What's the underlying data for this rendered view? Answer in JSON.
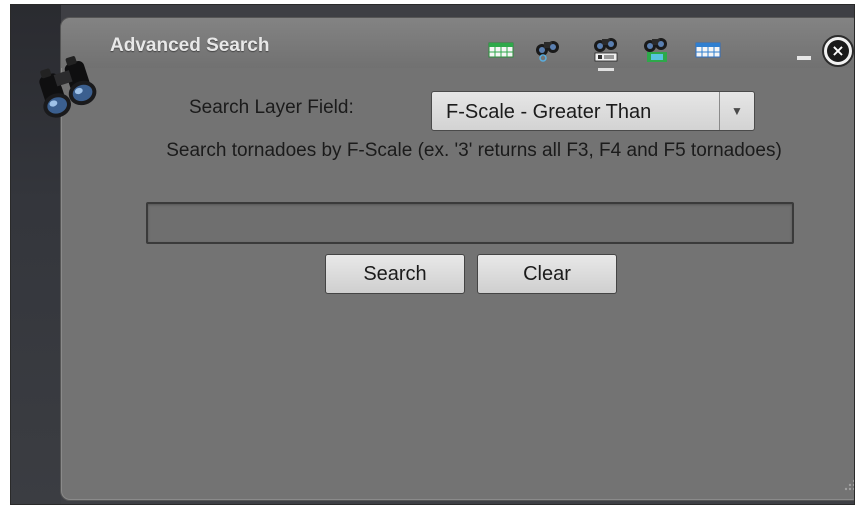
{
  "window": {
    "title": "Advanced Search",
    "toolbar_icons": [
      "table-icon",
      "binoculars-select-icon",
      "binoculars-text-icon",
      "binoculars-map-icon",
      "grid-table-icon"
    ],
    "active_tool": "binoculars-text-icon"
  },
  "form": {
    "field_label": "Search Layer Field:",
    "selected_field": "F-Scale - Greater Than",
    "help_text": "Search tornadoes by F-Scale (ex. '3' returns all F3, F4 and F5 tornadoes)",
    "search_value": "",
    "search_button": "Search",
    "clear_button": "Clear"
  },
  "colors": {
    "panel": "#737373",
    "header_text": "#e8e8e8",
    "accent_green": "#2ea84a",
    "accent_blue": "#2f7fd0"
  }
}
